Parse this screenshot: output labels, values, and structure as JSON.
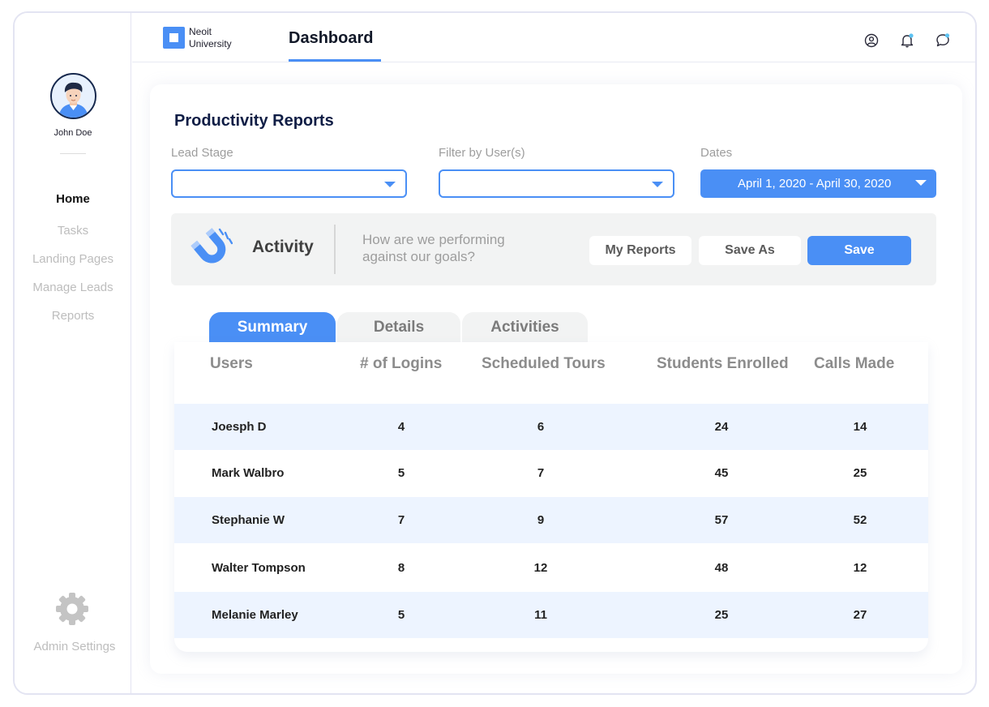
{
  "sidebar": {
    "username": "John Doe",
    "nav": [
      "Home",
      "Tasks",
      "Landing Pages",
      "Manage Leads",
      "Reports"
    ],
    "active": "Home",
    "admin_settings": "Admin Settings",
    "icons": {
      "avatar": "user-avatar",
      "settings": "gear-icon"
    }
  },
  "header": {
    "logo_line1": "Neoit",
    "logo_line2": "University",
    "tab": "Dashboard",
    "icons": [
      "user-circle-icon",
      "bell-icon",
      "chat-bubble-icon"
    ]
  },
  "page": {
    "title": "Productivity Reports",
    "filters": {
      "lead_stage_label": "Lead Stage",
      "filter_users_label": "Filter by User(s)",
      "dates_label": "Dates",
      "dates_value": "April 1, 2020 - April 30, 2020"
    },
    "activity": {
      "title": "Activity",
      "subtitle_line1": "How are we performing",
      "subtitle_line2": "against our goals?",
      "my_reports": "My Reports",
      "save_as": "Save As",
      "save": "Save",
      "icon": "magnet-icon"
    },
    "tabs": [
      "Summary",
      "Details",
      "Activities"
    ],
    "active_tab": "Summary",
    "table": {
      "headers": [
        "Users",
        "# of Logins",
        "Scheduled Tours",
        "Students Enrolled",
        "Calls Made"
      ],
      "rows": [
        [
          "Joesph D",
          "4",
          "6",
          "24",
          "14"
        ],
        [
          "Mark Walbro",
          "5",
          "7",
          "45",
          "25"
        ],
        [
          "Stephanie W",
          "7",
          "9",
          "57",
          "52"
        ],
        [
          "Walter Tompson",
          "8",
          "12",
          "48",
          "12"
        ],
        [
          "Melanie Marley",
          "5",
          "11",
          "25",
          "27"
        ]
      ]
    }
  },
  "colors": {
    "accent": "#4a8ff5",
    "title": "#0f1d45",
    "muted": "#bdbdbd",
    "row_shade": "#edf4ff"
  }
}
